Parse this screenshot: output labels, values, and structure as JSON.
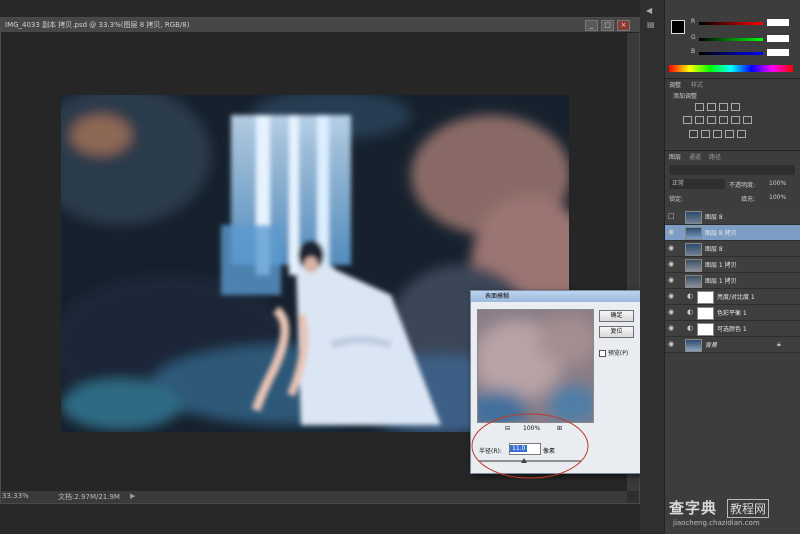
{
  "document": {
    "title": "IMG_4033 副本 拷贝.psd @ 33.3%(图层 8 拷贝, RGB/8)",
    "minimize": "_",
    "maximize": "□",
    "close": "×",
    "zoom_status": "33.33%",
    "doc_status": "文档:2.97M/21.9M"
  },
  "dialog": {
    "title": "表面模糊",
    "close": "×",
    "ok_label": "确定",
    "cancel_label": "复位",
    "preview_label": "预览(P)",
    "zoom_minus": "⊟",
    "zoom_value": "100%",
    "zoom_plus": "⊞",
    "radius_label": "半径(R):",
    "radius_value": "11.0",
    "radius_unit": "像素"
  },
  "color_panel": {
    "channels": [
      "R",
      "G",
      "B"
    ]
  },
  "adjustments_panel": {
    "tab_label": "调整",
    "tab2_label": "样式",
    "heading": "添加调整"
  },
  "layers_panel": {
    "tabs": [
      "图层",
      "通道",
      "路径"
    ],
    "blend_mode": "正常",
    "opacity_label": "不透明度:",
    "opacity": "100%",
    "lock_label": "锁定:",
    "fill_label": "填充:",
    "fill": "100%",
    "layers": [
      {
        "name": "图层 8",
        "visible": false,
        "selected": false
      },
      {
        "name": "图层 8 拷贝",
        "visible": true,
        "selected": true
      },
      {
        "name": "图层 8",
        "visible": true,
        "selected": false
      },
      {
        "name": "图层 1 拷贝",
        "visible": true,
        "selected": false
      },
      {
        "name": "图层 1 拷贝",
        "visible": true,
        "selected": false
      },
      {
        "name": "亮度/对比度 1",
        "visible": true,
        "selected": false
      },
      {
        "name": "色彩平衡 1",
        "visible": true,
        "selected": false
      },
      {
        "name": "可选颜色 1",
        "visible": true,
        "selected": false
      },
      {
        "name": "背景",
        "visible": true,
        "selected": false
      }
    ]
  },
  "watermark": {
    "brand": "查字典",
    "sub": "教程网",
    "url": "jiaocheng.chazidian.com"
  },
  "colors": {
    "accent_selected": "#7d9dc4",
    "annotation_circle": "#c0392b"
  }
}
